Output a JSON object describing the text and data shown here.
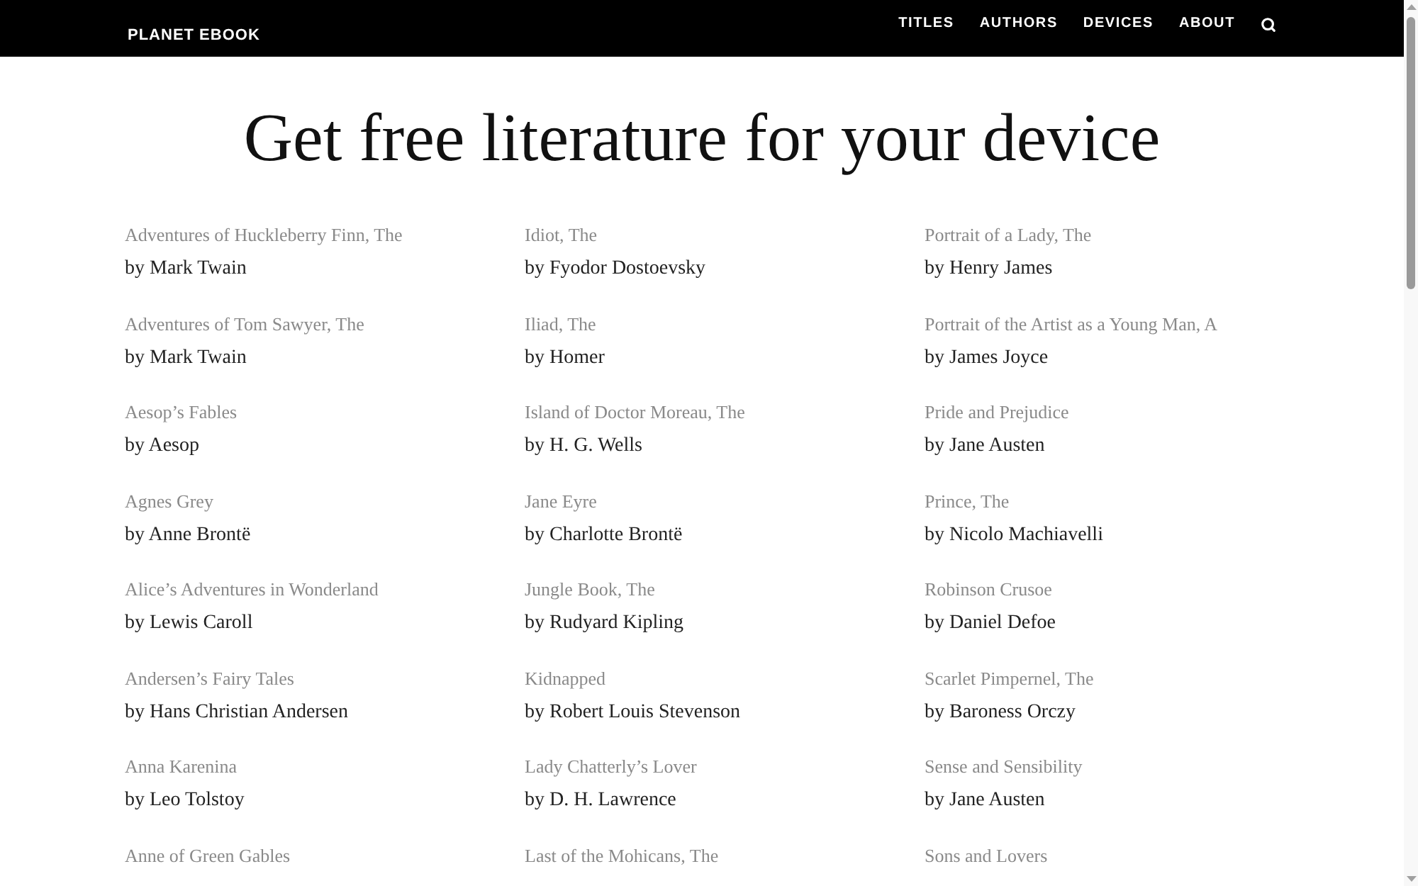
{
  "header": {
    "logo": "PLANET EBOOK",
    "nav": [
      {
        "label": "TITLES"
      },
      {
        "label": "AUTHORS"
      },
      {
        "label": "DEVICES"
      },
      {
        "label": "ABOUT"
      }
    ]
  },
  "heading": "Get free literature for your device",
  "columns": [
    {
      "books": [
        {
          "title": "Adventures of Huckleberry Finn, The",
          "author": "by Mark Twain"
        },
        {
          "title": "Adventures of Tom Sawyer, The",
          "author": "by Mark Twain"
        },
        {
          "title": "Aesop’s Fables",
          "author": "by Aesop"
        },
        {
          "title": "Agnes Grey",
          "author": "by Anne Brontë"
        },
        {
          "title": "Alice’s Adventures in Wonderland",
          "author": "by Lewis Caroll"
        },
        {
          "title": "Andersen’s Fairy Tales",
          "author": "by Hans Christian Andersen"
        },
        {
          "title": "Anna Karenina",
          "author": "by Leo Tolstoy"
        },
        {
          "title": "Anne of Green Gables"
        }
      ]
    },
    {
      "books": [
        {
          "title": "Idiot, The",
          "author": "by Fyodor Dostoevsky"
        },
        {
          "title": "Iliad, The",
          "author": "by Homer"
        },
        {
          "title": "Island of Doctor Moreau, The",
          "author": "by H. G. Wells"
        },
        {
          "title": "Jane Eyre",
          "author": "by Charlotte Brontë"
        },
        {
          "title": "Jungle Book, The",
          "author": "by Rudyard Kipling"
        },
        {
          "title": "Kidnapped",
          "author": "by Robert Louis Stevenson"
        },
        {
          "title": "Lady Chatterly’s Lover",
          "author": "by D. H. Lawrence"
        },
        {
          "title": "Last of the Mohicans, The"
        }
      ]
    },
    {
      "books": [
        {
          "title": "Portrait of a Lady, The",
          "author": "by Henry James"
        },
        {
          "title": "Portrait of the Artist as a Young Man, A",
          "author": "by James Joyce"
        },
        {
          "title": "Pride and Prejudice",
          "author": "by Jane Austen"
        },
        {
          "title": "Prince, The",
          "author": "by Nicolo Machiavelli"
        },
        {
          "title": "Robinson Crusoe",
          "author": "by Daniel Defoe"
        },
        {
          "title": "Scarlet Pimpernel, The",
          "author": "by Baroness Orczy"
        },
        {
          "title": "Sense and Sensibility",
          "author": "by Jane Austen"
        },
        {
          "title": "Sons and Lovers"
        }
      ]
    }
  ]
}
